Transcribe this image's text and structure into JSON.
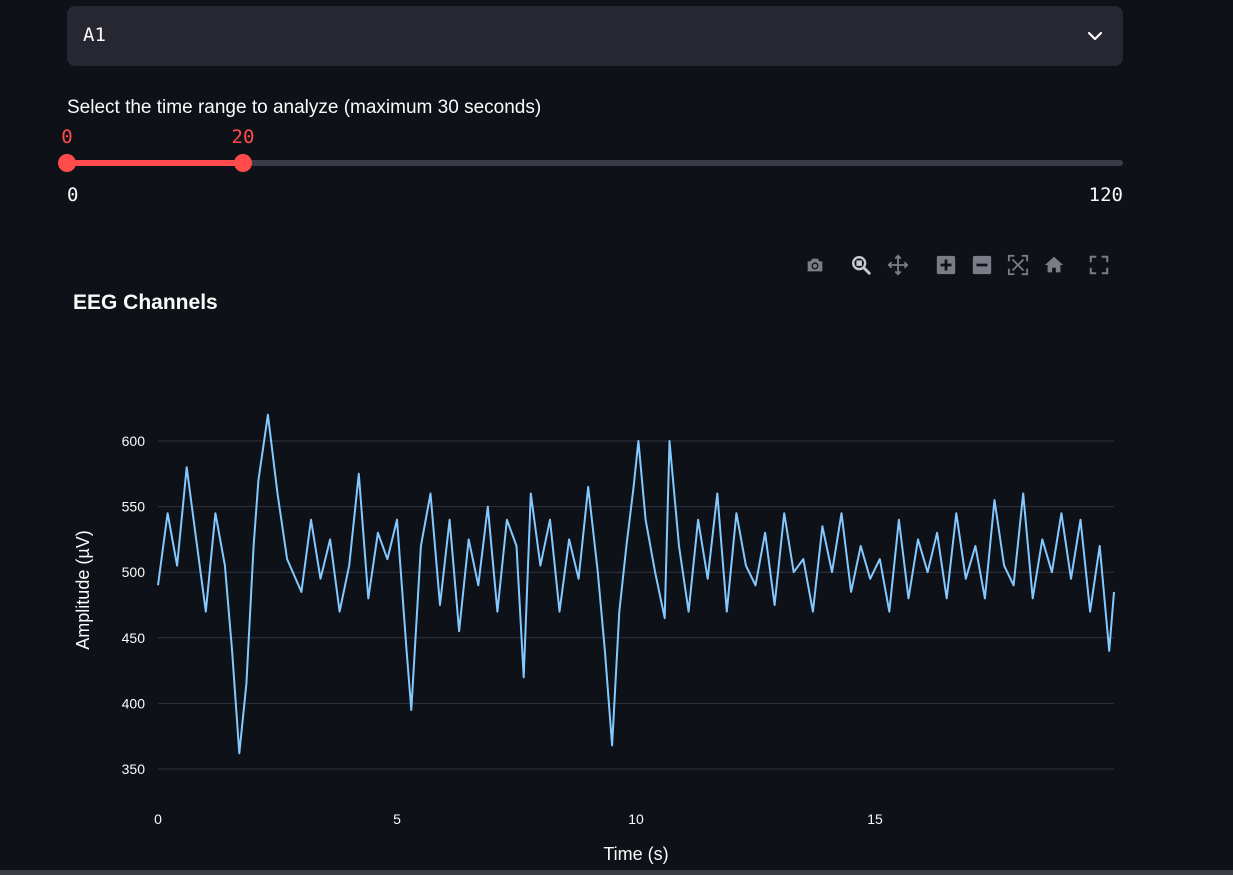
{
  "select": {
    "value": "A1"
  },
  "slider": {
    "label": "Select the time range to analyze (maximum 30 seconds)",
    "min": 0,
    "max": 120,
    "low": 0,
    "high": 20,
    "low_label": "0",
    "high_label": "20",
    "min_label": "0",
    "max_label": "120"
  },
  "modebar": {
    "icons": [
      "camera-icon",
      "zoom-icon",
      "pan-icon",
      "zoom-in-icon",
      "zoom-out-icon",
      "autoscale-icon",
      "home-icon",
      "fullscreen-icon"
    ]
  },
  "colors": {
    "accent": "#ff4b4b",
    "line": "#83c9ff",
    "background": "#0e1117",
    "grid": "#31333f"
  },
  "chart_data": {
    "type": "line",
    "title": "EEG Channels",
    "xlabel": "Time (s)",
    "ylabel": "Amplitude (µV)",
    "xlim": [
      0,
      20
    ],
    "ylim": [
      340,
      630
    ],
    "xticks": [
      0,
      5,
      10,
      15
    ],
    "xtick_labels": [
      "0",
      "5",
      "10",
      "15"
    ],
    "yticks": [
      350,
      400,
      450,
      500,
      550,
      600
    ],
    "ytick_labels": [
      "350",
      "400",
      "450",
      "500",
      "550",
      "600"
    ],
    "grid": true,
    "series": [
      {
        "x": [
          0,
          0.2,
          0.4,
          0.6,
          0.8,
          1.0,
          1.2,
          1.4,
          1.55,
          1.7,
          1.85,
          2.0,
          2.1,
          2.3,
          2.5,
          2.7,
          3.0,
          3.2,
          3.4,
          3.6,
          3.8,
          4.0,
          4.2,
          4.4,
          4.6,
          4.8,
          5.0,
          5.2,
          5.3,
          5.5,
          5.7,
          5.9,
          6.1,
          6.3,
          6.5,
          6.7,
          6.9,
          7.1,
          7.3,
          7.5,
          7.65,
          7.8,
          8.0,
          8.2,
          8.4,
          8.6,
          8.8,
          9.0,
          9.2,
          9.35,
          9.5,
          9.65,
          9.8,
          9.95,
          10.05,
          10.2,
          10.4,
          10.6,
          10.7,
          10.9,
          11.1,
          11.3,
          11.5,
          11.7,
          11.9,
          12.1,
          12.3,
          12.5,
          12.7,
          12.9,
          13.1,
          13.3,
          13.5,
          13.7,
          13.9,
          14.1,
          14.3,
          14.5,
          14.7,
          14.9,
          15.1,
          15.3,
          15.5,
          15.7,
          15.9,
          16.1,
          16.3,
          16.5,
          16.7,
          16.9,
          17.1,
          17.3,
          17.5,
          17.7,
          17.9,
          18.1,
          18.3,
          18.5,
          18.7,
          18.9,
          19.1,
          19.3,
          19.5,
          19.7,
          19.9,
          20.0
        ],
        "y": [
          490,
          545,
          505,
          580,
          525,
          470,
          545,
          505,
          440,
          362,
          415,
          520,
          570,
          620,
          560,
          510,
          485,
          540,
          495,
          525,
          470,
          505,
          575,
          480,
          530,
          510,
          540,
          440,
          395,
          520,
          560,
          475,
          540,
          455,
          525,
          490,
          550,
          470,
          540,
          520,
          420,
          560,
          505,
          540,
          470,
          525,
          495,
          565,
          500,
          440,
          368,
          470,
          520,
          565,
          600,
          540,
          500,
          465,
          600,
          520,
          470,
          540,
          495,
          560,
          470,
          545,
          505,
          490,
          530,
          475,
          545,
          500,
          510,
          470,
          535,
          500,
          545,
          485,
          520,
          495,
          510,
          470,
          540,
          480,
          525,
          500,
          530,
          480,
          545,
          495,
          520,
          480,
          555,
          505,
          490,
          560,
          480,
          525,
          500,
          545,
          495,
          540,
          470,
          520,
          440,
          485
        ]
      }
    ]
  }
}
